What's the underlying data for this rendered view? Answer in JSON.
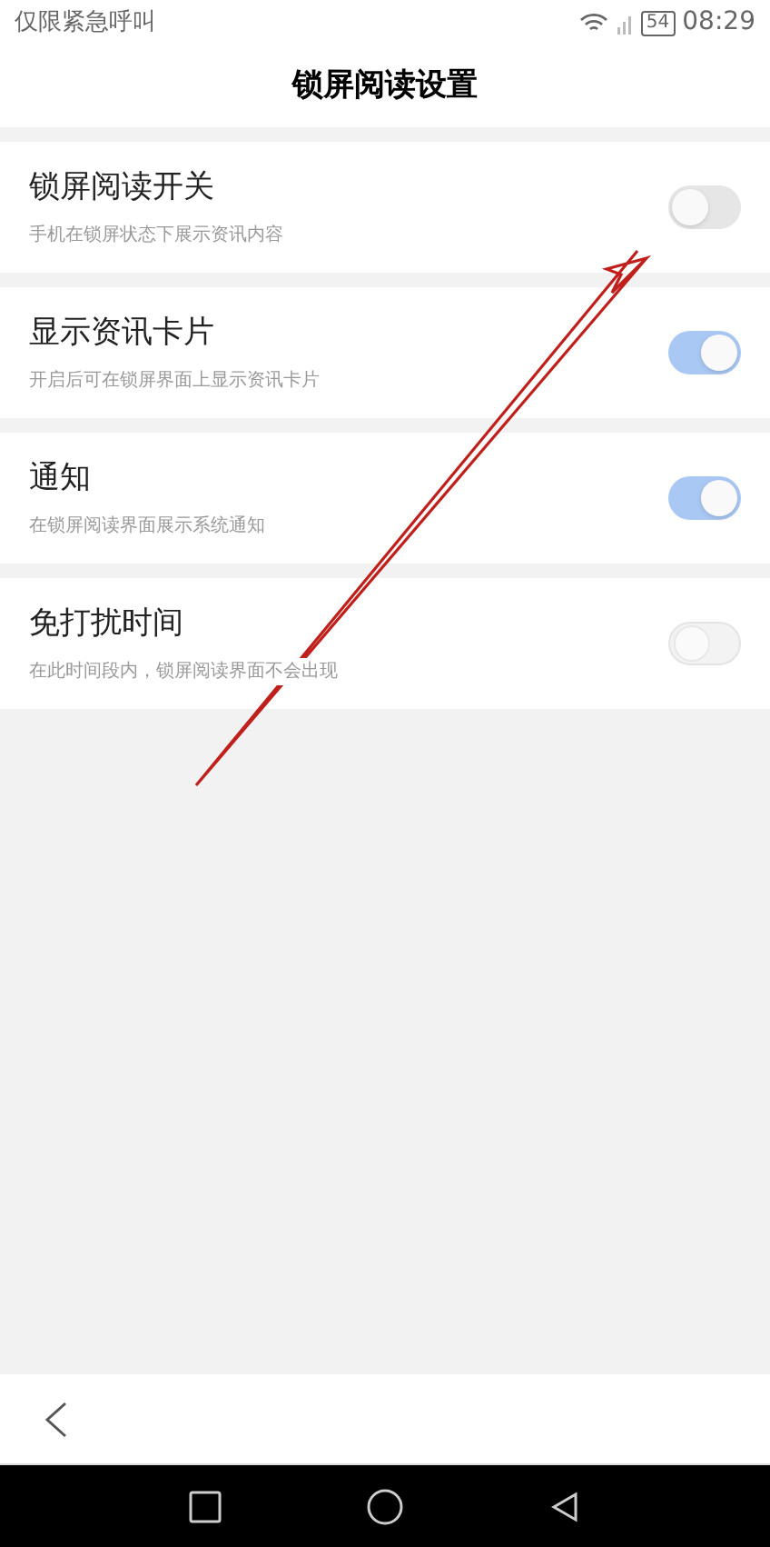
{
  "status_bar": {
    "carrier": "仅限紧急呼叫",
    "battery": "54",
    "time": "08:29"
  },
  "title": "锁屏阅读设置",
  "settings": [
    {
      "label": "锁屏阅读开关",
      "description": "手机在锁屏状态下展示资讯内容",
      "on": false,
      "disabled": false
    },
    {
      "label": "显示资讯卡片",
      "description": "开启后可在锁屏界面上显示资讯卡片",
      "on": true,
      "disabled": false
    },
    {
      "label": "通知",
      "description": "在锁屏阅读界面展示系统通知",
      "on": true,
      "disabled": false
    },
    {
      "label": "免打扰时间",
      "description": "在此时间段内，锁屏阅读界面不会出现",
      "on": false,
      "disabled": true
    }
  ]
}
